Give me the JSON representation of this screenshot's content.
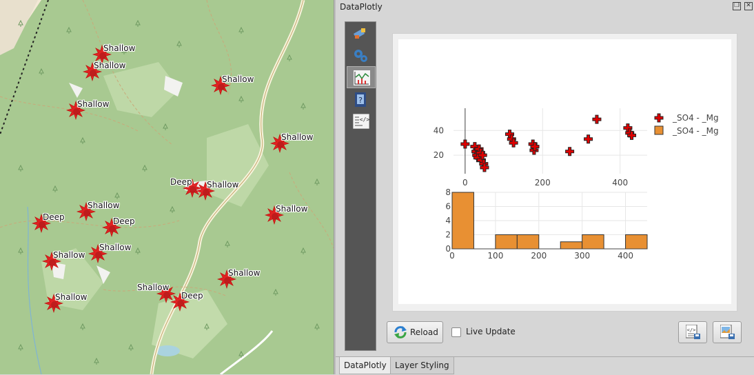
{
  "map": {
    "markers": [
      {
        "label": "Shallow",
        "color": "#e31a1c"
      },
      {
        "label": "Shallow",
        "color": "#e31a1c"
      },
      {
        "label": "Shallow",
        "color": "#e31a1c"
      },
      {
        "label": "Shallow",
        "color": "#e31a1c"
      },
      {
        "label": "Shallow",
        "color": "#e31a1c"
      },
      {
        "label": "Deep",
        "color": "#e31a1c"
      },
      {
        "label": "Shallow",
        "color": "#e31a1c"
      },
      {
        "label": "Shallow",
        "color": "#e31a1c"
      },
      {
        "label": "Shallow",
        "color": "#e31a1c"
      },
      {
        "label": "Deep",
        "color": "#e31a1c"
      },
      {
        "label": "Deep",
        "color": "#e31a1c"
      },
      {
        "label": "Shallow",
        "color": "#e31a1c"
      },
      {
        "label": "Shallow",
        "color": "#e31a1c"
      },
      {
        "label": "Shallow",
        "color": "#e31a1c"
      },
      {
        "label": "Shallow",
        "color": "#e31a1c"
      },
      {
        "label": "Deep",
        "color": "#e31a1c"
      },
      {
        "label": "Shallow",
        "color": "#e31a1c"
      },
      {
        "label": "Deep",
        "color": "#e31a1c"
      }
    ]
  },
  "panel": {
    "title": "DataPlotly",
    "toolbar": [
      {
        "icon": "style-brush-icon"
      },
      {
        "icon": "settings-gears-icon"
      },
      {
        "icon": "plot-chart-icon"
      },
      {
        "icon": "help-book-icon"
      },
      {
        "icon": "code-html-icon"
      }
    ],
    "reload_label": "Reload",
    "live_update_label": "Live Update",
    "live_update_checked": false,
    "tabs": [
      {
        "label": "DataPlotly",
        "active": true
      },
      {
        "label": "Layer Styling",
        "active": false
      }
    ]
  },
  "chart_data": [
    {
      "type": "scatter",
      "series": [
        {
          "name": "_SO4 - _Mg",
          "marker": "cross",
          "color": "#e00000"
        }
      ],
      "points": [
        [
          0,
          29
        ],
        [
          25,
          27
        ],
        [
          28,
          23
        ],
        [
          30,
          20
        ],
        [
          33,
          18
        ],
        [
          36,
          25
        ],
        [
          40,
          22
        ],
        [
          42,
          16
        ],
        [
          45,
          20
        ],
        [
          48,
          13
        ],
        [
          50,
          10
        ],
        [
          115,
          37
        ],
        [
          120,
          33
        ],
        [
          125,
          30
        ],
        [
          175,
          29
        ],
        [
          178,
          24
        ],
        [
          180,
          27
        ],
        [
          270,
          23
        ],
        [
          318,
          33
        ],
        [
          340,
          49
        ],
        [
          420,
          42
        ],
        [
          425,
          38
        ],
        [
          430,
          36
        ]
      ],
      "xticks": [
        "0",
        "200",
        "400"
      ],
      "yticks": [
        "20",
        "40"
      ],
      "xlim": [
        -30,
        470
      ],
      "ylim": [
        5,
        58
      ],
      "grid": true,
      "legend": "top-right"
    },
    {
      "type": "bar",
      "series": [
        {
          "name": "_SO4 - _Mg",
          "color": "#e89033"
        }
      ],
      "bins": [
        {
          "x0": 0,
          "x1": 50,
          "count": 8
        },
        {
          "x0": 100,
          "x1": 150,
          "count": 2
        },
        {
          "x0": 150,
          "x1": 200,
          "count": 2
        },
        {
          "x0": 250,
          "x1": 300,
          "count": 1
        },
        {
          "x0": 300,
          "x1": 350,
          "count": 2
        },
        {
          "x0": 400,
          "x1": 450,
          "count": 2
        }
      ],
      "xticks": [
        "0",
        "100",
        "200",
        "300",
        "400"
      ],
      "yticks": [
        "0",
        "2",
        "4",
        "6",
        "8"
      ],
      "xlim": [
        0,
        450
      ],
      "ylim": [
        0,
        8
      ],
      "grid": true
    }
  ]
}
